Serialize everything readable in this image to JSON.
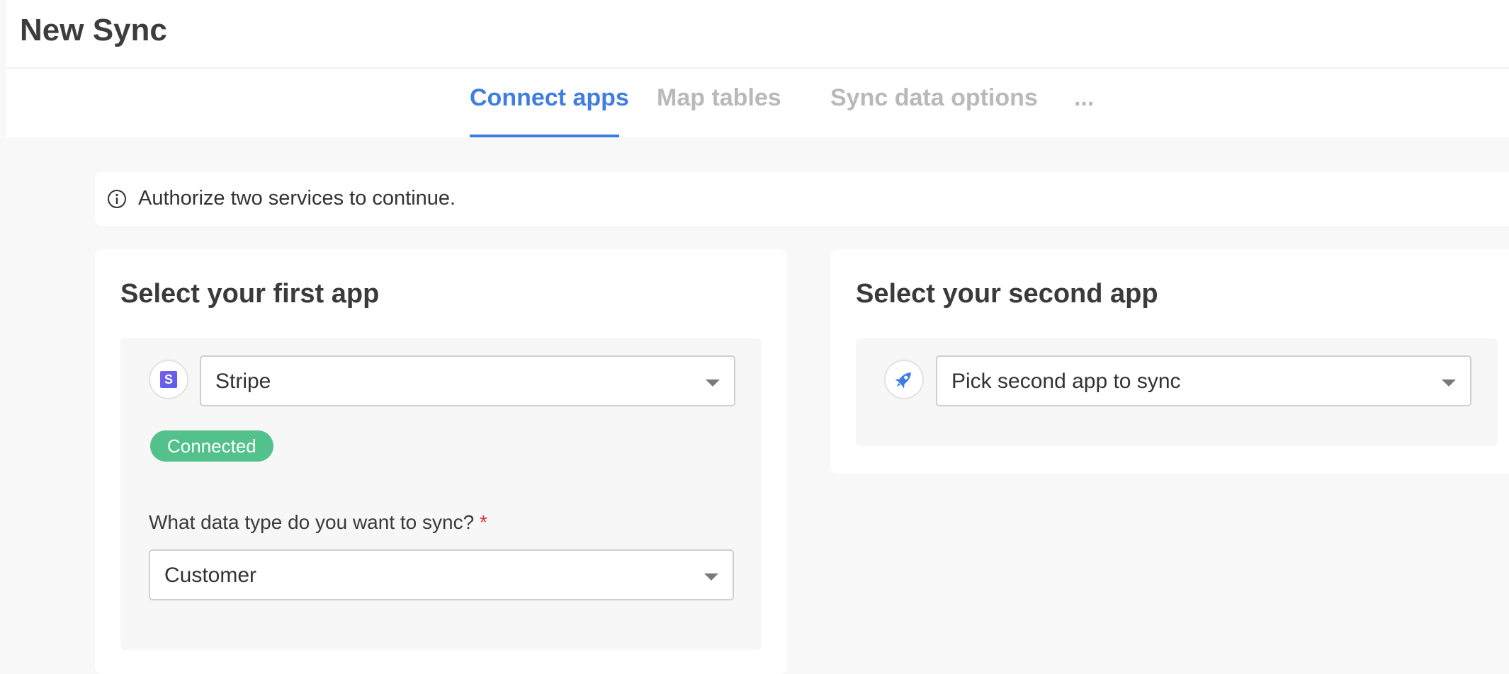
{
  "header": {
    "title": "New Sync"
  },
  "tabs": [
    {
      "label": "Connect apps",
      "active": true
    },
    {
      "label": "Map tables",
      "active": false
    },
    {
      "label": "Sync data options",
      "active": false
    },
    {
      "label": "...",
      "active": false
    }
  ],
  "banner": {
    "icon": "info-circle-icon",
    "text": "Authorize two services to continue."
  },
  "first_app": {
    "title": "Select your first app",
    "app_icon": "stripe-logo-icon",
    "selected_app": "Stripe",
    "status_badge": "Connected",
    "data_type_label": "What data type do you want to sync?",
    "required_marker": "*",
    "data_type_value": "Customer"
  },
  "second_app": {
    "title": "Select your second app",
    "app_icon": "rocket-icon",
    "placeholder": "Pick second app to sync"
  },
  "colors": {
    "accent": "#3f7ee0",
    "connected": "#52c18c",
    "required": "#d0352f"
  }
}
